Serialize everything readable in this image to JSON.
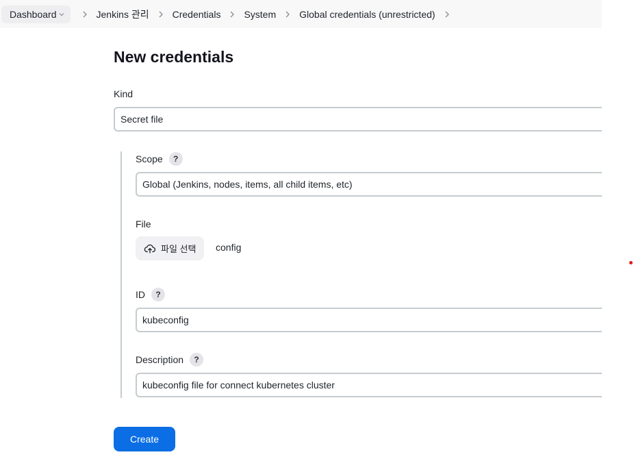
{
  "breadcrumb": {
    "items": [
      {
        "label": "Dashboard"
      },
      {
        "label": "Jenkins 관리"
      },
      {
        "label": "Credentials"
      },
      {
        "label": "System"
      },
      {
        "label": "Global credentials (unrestricted)"
      }
    ]
  },
  "form": {
    "title": "New credentials",
    "kind": {
      "label": "Kind",
      "value": "Secret file"
    },
    "scope": {
      "label": "Scope",
      "help": "?",
      "value": "Global (Jenkins, nodes, items, all child items, etc)"
    },
    "file": {
      "label": "File",
      "button_label": "파일 선택",
      "file_name": "config"
    },
    "id": {
      "label": "ID",
      "help": "?",
      "value": "kubeconfig"
    },
    "description": {
      "label": "Description",
      "help": "?",
      "value": "kubeconfig file for connect kubernetes cluster"
    },
    "submit_label": "Create"
  },
  "colors": {
    "primary": "#0b6ee4",
    "breadcrumb_bg": "#f8f8f9",
    "field_border": "#c5cbcf",
    "marker": "#e31b1b"
  },
  "icons": {
    "breadcrumb_separator": "chevron-right-icon",
    "dashboard_dropdown": "chevron-down-icon",
    "file_button": "cloud-upload-icon"
  }
}
